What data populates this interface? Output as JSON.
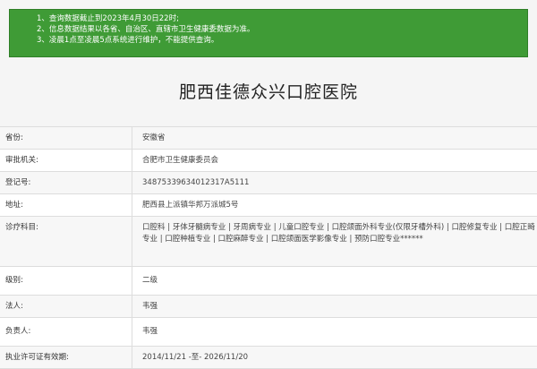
{
  "notice": {
    "lines": [
      "1、查询数据截止到2023年4月30日22时;",
      "2、信息数据结果以各省、自治区、直辖市卫生健康委数据为准。",
      "3、凌晨1点至凌晨5点系统进行维护，不能提供查询。"
    ],
    "color": "#3f9b36"
  },
  "title": "肥西佳德众兴口腔医院",
  "fields": [
    {
      "label": "省份:",
      "value": "安徽省"
    },
    {
      "label": "审批机关:",
      "value": "合肥市卫生健康委员会"
    },
    {
      "label": "登记号:",
      "value": "348753396340123​17A5111"
    },
    {
      "label": "地址:",
      "value": "肥西县上派镇华邦万派城5号"
    },
    {
      "label": "诊疗科目:",
      "value": "口腔科 | 牙体牙髓病专业 | 牙周病专业 | 儿童口腔专业 | 口腔颌面外科专业(仅限牙槽外科) | 口腔修复专业 | 口腔正畸专业 | 口腔种植专业 | 口腔麻醉专业 | 口腔颌面医学影像专业 | 预防口腔专业******"
    },
    {
      "label": "级别:",
      "value": "二级"
    },
    {
      "label": "法人:",
      "value": "韦强"
    },
    {
      "label": "负责人:",
      "value": "韦强"
    },
    {
      "label": "执业许可证有效期:",
      "value": "2014/11/21 -至- 2026/11/20"
    }
  ]
}
